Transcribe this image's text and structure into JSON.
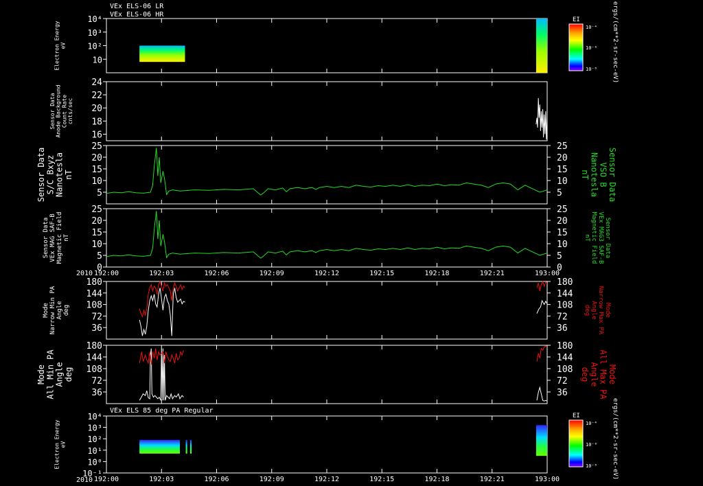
{
  "header": {
    "line1": "VEx ELS-06 LR",
    "line2": "VEx ELS-06 HR"
  },
  "spectrogram_title": "VEx ELS 85 deg PA Regular",
  "year": "2010",
  "x_ticks": [
    "192:00",
    "192:03",
    "192:06",
    "192:09",
    "192:12",
    "192:15",
    "192:18",
    "192:21",
    "193:00"
  ],
  "x_range_minutes": [
    0,
    60
  ],
  "colorbar": {
    "label": "EI",
    "ticks": [
      "10⁻⁴",
      "10⁻⁶",
      "10⁻⁸"
    ],
    "unit": "ergs/(cm**2-sr-sec-eV)"
  },
  "colors": {
    "white": "#ffffff",
    "green": "#22dd22",
    "red": "#ee1111",
    "background": "#000000"
  },
  "chart_data": [
    {
      "id": "p1",
      "type": "heatmap",
      "ylabel": [
        "Electron Energy",
        "eV"
      ],
      "ytick_labels": [
        "10⁴",
        "10³",
        "10²",
        "10"
      ],
      "ylog_range": [
        0,
        4
      ],
      "blocks": [
        {
          "x": [
            4.5,
            10.7
          ],
          "ylog": [
            0.8,
            2.0
          ]
        },
        {
          "x": [
            58.5,
            60
          ],
          "ylog": [
            0.0,
            4.0
          ]
        }
      ]
    },
    {
      "id": "p2",
      "type": "line",
      "ylabel": [
        "Sensor Data",
        "Anode Background",
        "Count Rate",
        "cnts/sec"
      ],
      "ylim": [
        15,
        24
      ],
      "yticks": [
        16,
        18,
        20,
        22,
        24
      ],
      "series": [
        {
          "color": "white",
          "x": [
            58.5,
            58.6,
            58.7,
            58.8,
            58.9,
            59.0,
            59.1,
            59.2,
            59.3,
            59.4,
            59.5,
            59.6,
            59.7,
            59.8,
            59.9,
            60.0
          ],
          "y": [
            17.5,
            18.5,
            17.0,
            21.5,
            18.5,
            20.5,
            16.5,
            19.5,
            17.0,
            19.8,
            15.5,
            19.0,
            16.0,
            19.5,
            15.2,
            18.5
          ]
        }
      ]
    },
    {
      "id": "p3",
      "type": "line",
      "ylabel": [
        "Sensor Data",
        "S/C Bxyz",
        "Nanotesla",
        "nT"
      ],
      "ylabel_right": [
        "Sensor Data",
        "VSO B",
        "Nanotesla",
        "nT"
      ],
      "ylim": [
        0,
        25
      ],
      "yticks": [
        5,
        10,
        15,
        20,
        25
      ],
      "series": [
        {
          "color": "green",
          "x": [
            0,
            1,
            2,
            3,
            4,
            5,
            6,
            6.3,
            6.5,
            6.8,
            7.0,
            7.2,
            7.4,
            7.7,
            7.9,
            8.2,
            8.5,
            9,
            10,
            12,
            14,
            16,
            18,
            20,
            21,
            21.5,
            22,
            23,
            24,
            24.5,
            25,
            26,
            27,
            28,
            28.5,
            29,
            30,
            31,
            32,
            33,
            34,
            35,
            36,
            37,
            38,
            39,
            40,
            41,
            42,
            43,
            44,
            45,
            46,
            47,
            48,
            49,
            50,
            51,
            52,
            53,
            54,
            55,
            56,
            57,
            58,
            59,
            60
          ],
          "y": [
            4.5,
            5.0,
            4.8,
            5.2,
            4.8,
            4.6,
            5.0,
            8,
            16,
            24,
            12,
            20,
            9,
            14,
            11,
            4,
            5.5,
            6,
            5.5,
            6,
            5.8,
            6.2,
            6,
            6.5,
            3.8,
            5,
            6.5,
            6,
            6.8,
            5.2,
            6.5,
            7,
            6.5,
            7,
            6.2,
            7,
            7.5,
            7,
            7.5,
            7,
            8,
            7.5,
            7.2,
            7.8,
            7.5,
            8,
            7.5,
            8.2,
            7.5,
            8,
            7.8,
            8.5,
            7.8,
            8.2,
            8,
            9,
            8.5,
            8,
            7,
            8.5,
            9,
            8.5,
            6,
            8,
            6.5,
            5,
            6
          ]
        }
      ]
    },
    {
      "id": "p4",
      "type": "line",
      "ylabel": [
        "Sensor Data",
        "VEx MAG SAF-B",
        "Magnetic Field",
        "nT"
      ],
      "ylabel_right": [
        "Sensor Data",
        "VEx MAG3 SAF-B",
        "Magnetic Field",
        "nT"
      ],
      "ylim": [
        0,
        25
      ],
      "yticks": [
        0,
        5,
        10,
        15,
        20,
        25
      ],
      "series": [
        {
          "color": "green",
          "x": [
            0,
            1,
            2,
            3,
            4,
            5,
            6,
            6.3,
            6.5,
            6.8,
            7.0,
            7.2,
            7.4,
            7.7,
            7.9,
            8.2,
            8.5,
            9,
            10,
            12,
            14,
            16,
            18,
            20,
            21,
            21.5,
            22,
            23,
            24,
            24.5,
            25,
            26,
            27,
            28,
            28.5,
            29,
            30,
            31,
            32,
            33,
            34,
            35,
            36,
            37,
            38,
            39,
            40,
            41,
            42,
            43,
            44,
            45,
            46,
            47,
            48,
            49,
            50,
            51,
            52,
            53,
            54,
            55,
            56,
            57,
            58,
            59,
            60
          ],
          "y": [
            4.5,
            5.0,
            4.8,
            5.2,
            4.8,
            4.6,
            5.0,
            8,
            16,
            24,
            12,
            20,
            9,
            14,
            11,
            4,
            5.5,
            6,
            5.5,
            6,
            5.8,
            6.2,
            6,
            6.5,
            3.8,
            5,
            6.5,
            6,
            6.8,
            5.2,
            6.5,
            7,
            6.5,
            7,
            6.2,
            7,
            7.5,
            7,
            7.5,
            7,
            8,
            7.5,
            7.2,
            7.8,
            7.5,
            8,
            7.5,
            8.2,
            7.5,
            8,
            7.8,
            8.5,
            7.8,
            8.2,
            8,
            9,
            8.5,
            8,
            7,
            8.5,
            9,
            8.5,
            6,
            8,
            6.5,
            5,
            6
          ]
        }
      ]
    },
    {
      "id": "p5",
      "type": "line",
      "ylabel": [
        "Mode",
        "Narrow Min PA",
        "Angle",
        "deg"
      ],
      "ylabel_right": [
        "Mode",
        "Narrow Max PA",
        "Angle",
        "deg"
      ],
      "ylim": [
        0,
        180
      ],
      "yticks": [
        36,
        72,
        108,
        144,
        180
      ],
      "series": [
        {
          "color": "white",
          "x": [
            4.5,
            4.7,
            4.9,
            5.1,
            5.3,
            5.5,
            5.7,
            5.9,
            6.1,
            6.3,
            6.5,
            6.7,
            6.9,
            7.1,
            7.3,
            7.5,
            7.7,
            7.9,
            8.1,
            8.3,
            8.5,
            8.7,
            8.9,
            9.1,
            9.3,
            9.5,
            9.7,
            9.9,
            10.1,
            10.3,
            10.5,
            10.7
          ],
          "y": [
            60,
            40,
            10,
            30,
            15,
            40,
            90,
            120,
            135,
            120,
            140,
            110,
            100,
            140,
            160,
            125,
            90,
            130,
            140,
            120,
            110,
            75,
            10,
            140,
            160,
            130,
            115,
            120,
            125,
            110,
            118,
            115
          ]
        },
        {
          "color": "white",
          "x": [
            58.6,
            58.9,
            59.1,
            59.3,
            59.6,
            59.8,
            60.0
          ],
          "y": [
            80,
            95,
            100,
            120,
            108,
            118,
            110
          ]
        },
        {
          "color": "red",
          "x": [
            4.5,
            4.7,
            4.9,
            5.1,
            5.3,
            5.5,
            5.7,
            5.9,
            6.1,
            6.3,
            6.5,
            6.7,
            6.9,
            7.1,
            7.3,
            7.5,
            7.7,
            7.9,
            8.1,
            8.3,
            8.5,
            8.7,
            8.9,
            9.1,
            9.3,
            9.5,
            9.7,
            9.9,
            10.1,
            10.3,
            10.5,
            10.7
          ],
          "y": [
            95,
            80,
            70,
            90,
            75,
            95,
            140,
            160,
            170,
            150,
            165,
            160,
            140,
            170,
            180,
            165,
            150,
            175,
            165,
            170,
            160,
            150,
            120,
            160,
            175,
            165,
            150,
            160,
            170,
            155,
            165,
            160
          ]
        },
        {
          "color": "red",
          "x": [
            58.6,
            58.8,
            59.0,
            59.2,
            59.4,
            59.6,
            59.8,
            60.0
          ],
          "y": [
            160,
            175,
            150,
            170,
            180,
            165,
            178,
            175
          ]
        }
      ]
    },
    {
      "id": "p6",
      "type": "line",
      "ylabel": [
        "Mode",
        "All Min PA",
        "Angle",
        "deg"
      ],
      "ylabel_right": [
        "Mode",
        "All Max PA",
        "Angle",
        "deg"
      ],
      "ylim": [
        0,
        180
      ],
      "yticks": [
        36,
        72,
        108,
        144,
        180
      ],
      "series": [
        {
          "color": "white",
          "x": [
            4.5,
            4.8,
            5.0,
            5.3,
            5.5,
            5.7,
            5.9,
            6.0,
            6.1,
            6.2,
            6.4,
            6.6,
            6.8,
            7.0,
            7.2,
            7.4,
            7.5,
            7.6,
            7.7,
            7.8,
            7.9,
            8.0,
            8.2,
            8.4,
            8.6,
            8.8,
            9.0,
            9.3,
            9.5,
            9.8,
            10.0,
            10.3,
            10.5
          ],
          "y": [
            10,
            22,
            30,
            25,
            40,
            18,
            15,
            150,
            170,
            30,
            20,
            25,
            20,
            15,
            20,
            10,
            170,
            10,
            170,
            10,
            150,
            10,
            25,
            20,
            15,
            30,
            15,
            25,
            20,
            30,
            15,
            25,
            20
          ]
        },
        {
          "color": "white",
          "x": [
            58.6,
            58.8,
            59.0,
            59.2,
            59.4,
            59.6,
            59.8,
            60.0
          ],
          "y": [
            10,
            35,
            50,
            30,
            10,
            8,
            10,
            8
          ]
        },
        {
          "color": "red",
          "x": [
            4.5,
            4.8,
            5.0,
            5.3,
            5.5,
            5.7,
            5.9,
            6.1,
            6.3,
            6.5,
            6.7,
            6.9,
            7.1,
            7.3,
            7.5,
            7.7,
            7.9,
            8.1,
            8.3,
            8.5,
            8.7,
            8.9,
            9.1,
            9.3,
            9.5,
            9.7,
            9.9,
            10.1,
            10.3,
            10.5
          ],
          "y": [
            125,
            160,
            130,
            150,
            135,
            125,
            160,
            120,
            160,
            140,
            170,
            135,
            160,
            150,
            155,
            160,
            125,
            160,
            145,
            135,
            130,
            150,
            140,
            125,
            155,
            135,
            140,
            160,
            150,
            165
          ]
        },
        {
          "color": "red",
          "x": [
            58.6,
            58.8,
            59.0,
            59.2,
            59.4,
            59.6,
            59.8,
            60.0
          ],
          "y": [
            130,
            155,
            140,
            170,
            165,
            175,
            178,
            175
          ]
        }
      ]
    },
    {
      "id": "p7",
      "type": "heatmap",
      "ylabel": [
        "Electron Energy",
        "eV"
      ],
      "ytick_labels": [
        "10⁴",
        "10³",
        "10²",
        "10¹",
        "10⁰",
        "10⁻¹"
      ],
      "ylog_range": [
        -1,
        4
      ],
      "blocks": [
        {
          "x": [
            4.5,
            10.0
          ],
          "ylog": [
            0.7,
            1.9
          ]
        },
        {
          "x": [
            10.8,
            11.0
          ],
          "ylog": [
            0.7,
            1.9
          ]
        },
        {
          "x": [
            11.4,
            11.6
          ],
          "ylog": [
            0.7,
            1.9
          ]
        },
        {
          "x": [
            58.5,
            60
          ],
          "ylog": [
            0.5,
            3.2
          ]
        }
      ]
    }
  ]
}
